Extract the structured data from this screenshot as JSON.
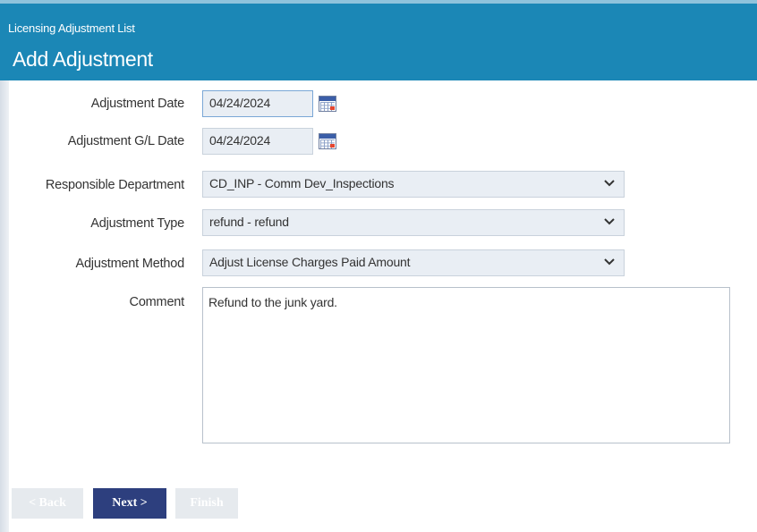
{
  "header": {
    "breadcrumb": "Licensing Adjustment List",
    "title": "Add Adjustment"
  },
  "form": {
    "adjustment_date": {
      "label": "Adjustment Date",
      "value": "04/24/2024"
    },
    "gl_date": {
      "label": "Adjustment G/L Date",
      "value": "04/24/2024"
    },
    "department": {
      "label": "Responsible Department",
      "value": "CD_INP - Comm Dev_Inspections"
    },
    "type": {
      "label": "Adjustment Type",
      "value": "refund - refund"
    },
    "method": {
      "label": "Adjustment Method",
      "value": "Adjust License Charges Paid Amount"
    },
    "comment": {
      "label": "Comment",
      "value": "Refund to the junk yard."
    }
  },
  "buttons": {
    "back": "< Back",
    "next": "Next >",
    "finish": "Finish"
  },
  "colors": {
    "header": "#1b87b6",
    "input_bg": "#e9eef4",
    "primary_button": "#2d3f7e",
    "disabled_button": "#e6eaee"
  },
  "icons": {
    "calendar": "calendar-icon",
    "dropdown": "chevron-down-icon"
  }
}
